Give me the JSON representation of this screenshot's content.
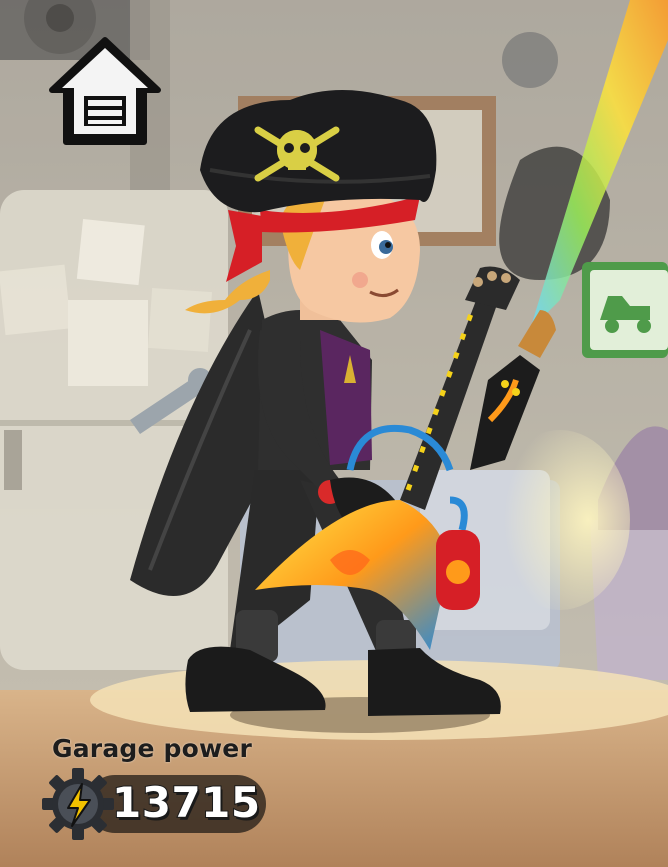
{
  "hud": {
    "garage_power_label": "Garage power",
    "garage_power_value": "13715"
  },
  "icons": {
    "home": "home-icon",
    "power": "lightning-gear-icon"
  },
  "colors": {
    "pirate_hat": "#1c1c1e",
    "bandana": "#d61f26",
    "hair": "#f0b03a",
    "guitar_yellow": "#f5d21a",
    "guitar_blue": "#2a8ad6",
    "power_bolt": "#f2c200",
    "pill_bg": "#28201a"
  }
}
